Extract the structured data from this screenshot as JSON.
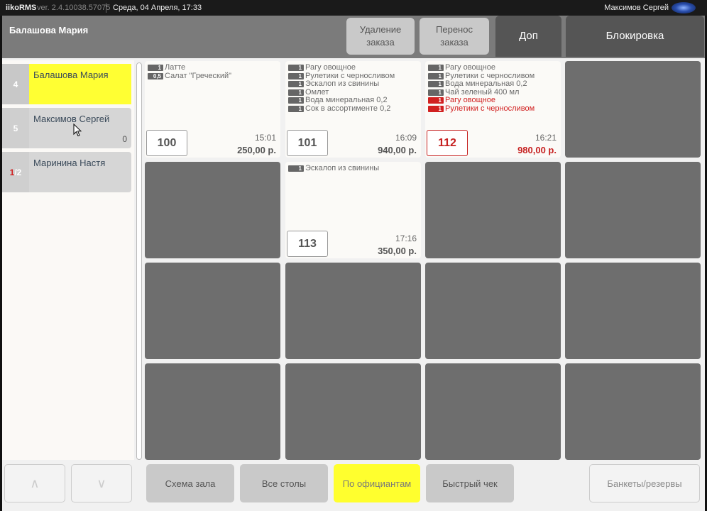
{
  "titlebar": {
    "app": "iikoRMS",
    "version": "ver. 2.4.10038.57075",
    "datetime": "Среда, 04 Апреля, 17:33",
    "user": "Максимов Сергей"
  },
  "header": {
    "waiter_name": "Балашова Мария",
    "delete_order": [
      "Удаление",
      "заказа"
    ],
    "move_order": [
      "Перенос",
      "заказа"
    ],
    "extra": "Доп",
    "lock": "Блокировка"
  },
  "waiters": [
    {
      "num": "4",
      "name": "Балашова Мария",
      "count": "",
      "active": true
    },
    {
      "num": "5",
      "name": "Максимов Сергей",
      "count": "0",
      "active": false
    },
    {
      "num_red": "1",
      "num_rest": "/2",
      "name": "Маринина Настя",
      "count": "",
      "active": false
    }
  ],
  "orders": [
    {
      "table": "100",
      "time": "15:01",
      "sum": "250,00 р.",
      "items": [
        {
          "qty": "1",
          "name": "Латте"
        },
        {
          "qty": "0,5",
          "name": "Салат \"Греческий\""
        }
      ]
    },
    {
      "table": "101",
      "time": "16:09",
      "sum": "940,00 р.",
      "items": [
        {
          "qty": "1",
          "name": "Рагу овощное"
        },
        {
          "qty": "1",
          "name": "Рулетики с черносливом"
        },
        {
          "qty": "1",
          "name": "Эскалоп из свинины"
        },
        {
          "qty": "1",
          "name": "Омлет"
        },
        {
          "qty": "1",
          "name": "Вода минеральная 0,2"
        },
        {
          "qty": "1",
          "name": "Сок в ассортименте 0,2"
        }
      ]
    },
    {
      "table": "112",
      "time": "16:21",
      "sum": "980,00 р.",
      "items": [
        {
          "qty": "1",
          "name": "Рагу овощное"
        },
        {
          "qty": "1",
          "name": "Рулетики с черносливом"
        },
        {
          "qty": "1",
          "name": "Вода минеральная 0,2"
        },
        {
          "qty": "1",
          "name": "Чай зеленый 400 мл"
        },
        {
          "qty": "1",
          "name": "Рагу овощное",
          "new": true
        },
        {
          "qty": "1",
          "name": "Рулетики с черносливом",
          "new": true
        }
      ]
    },
    {
      "table": "113",
      "time": "17:16",
      "sum": "350,00 р.",
      "items": [
        {
          "qty": "1",
          "name": "Эскалоп из свинины"
        }
      ]
    }
  ],
  "footer": {
    "up": "∧",
    "down": "∨",
    "hall": "Схема зала",
    "all_tables": "Все столы",
    "by_waiter": "По официантам",
    "quick_check": "Быстрый чек",
    "banquets": "Банкеты/резервы"
  },
  "colors": {
    "accent_yellow": "#ffff33",
    "alert_red": "#d12020",
    "empty_cell": "#6e6e6e"
  }
}
